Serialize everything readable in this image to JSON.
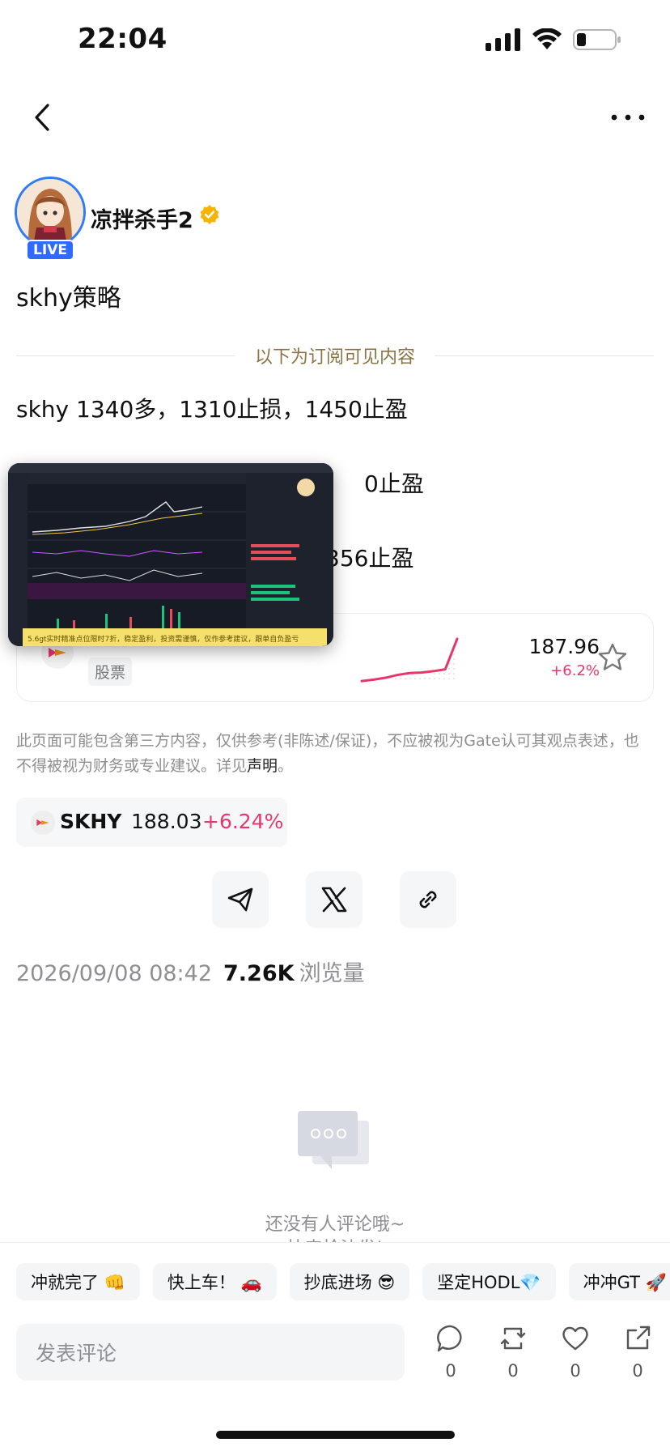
{
  "status_bar": {
    "time": "22:04"
  },
  "author": {
    "name": "凉拌杀手2",
    "live_label": "LIVE"
  },
  "post": {
    "title": "skhy策略",
    "subscriber_divider": "以下为订阅可见内容",
    "lines": [
      "skhy 1340多，1310止损，1450止盈",
      "0止盈",
      "356止盈"
    ]
  },
  "video_overlay": {
    "banner": "5.6gt实时精准点位限时7折，稳定盈利，投资需谨慎，仅作参考建议，跟单自负盈亏"
  },
  "stock_card": {
    "tag": "股票",
    "price": "187.96",
    "change": "+6.2%",
    "sparkline": [
      0.05,
      0.08,
      0.12,
      0.18,
      0.22,
      0.23,
      0.26,
      0.3,
      0.95
    ]
  },
  "disclaimer": {
    "text": "此页面可能包含第三方内容，仅供参考(非陈述/保证)，不应被视为Gate认可其观点表述，也不得被视为财务或专业建议。详见",
    "link": "声明",
    "end": "。"
  },
  "ticker": {
    "symbol": "SKHY",
    "price": "188.03",
    "change": "+6.24%"
  },
  "meta": {
    "datetime": "2026/09/08 08:42",
    "views": "7.26K",
    "views_label": "浏览量"
  },
  "empty_state": {
    "text": "还没有人评论哦~",
    "text2": "快来抢沙发!"
  },
  "quick_replies": [
    "冲就完了 👊",
    "快上车！ 🚗",
    "抄底进场 😎",
    "坚定HODL💎",
    "冲冲GT 🚀"
  ],
  "comment": {
    "placeholder": "发表评论"
  },
  "actions": {
    "comment_count": "0",
    "repost_count": "0",
    "like_count": "0",
    "share_count": "0"
  },
  "colors": {
    "accent_red": "#e8366b",
    "live_blue": "#2f6bff",
    "divider_gold": "#8a7444"
  }
}
